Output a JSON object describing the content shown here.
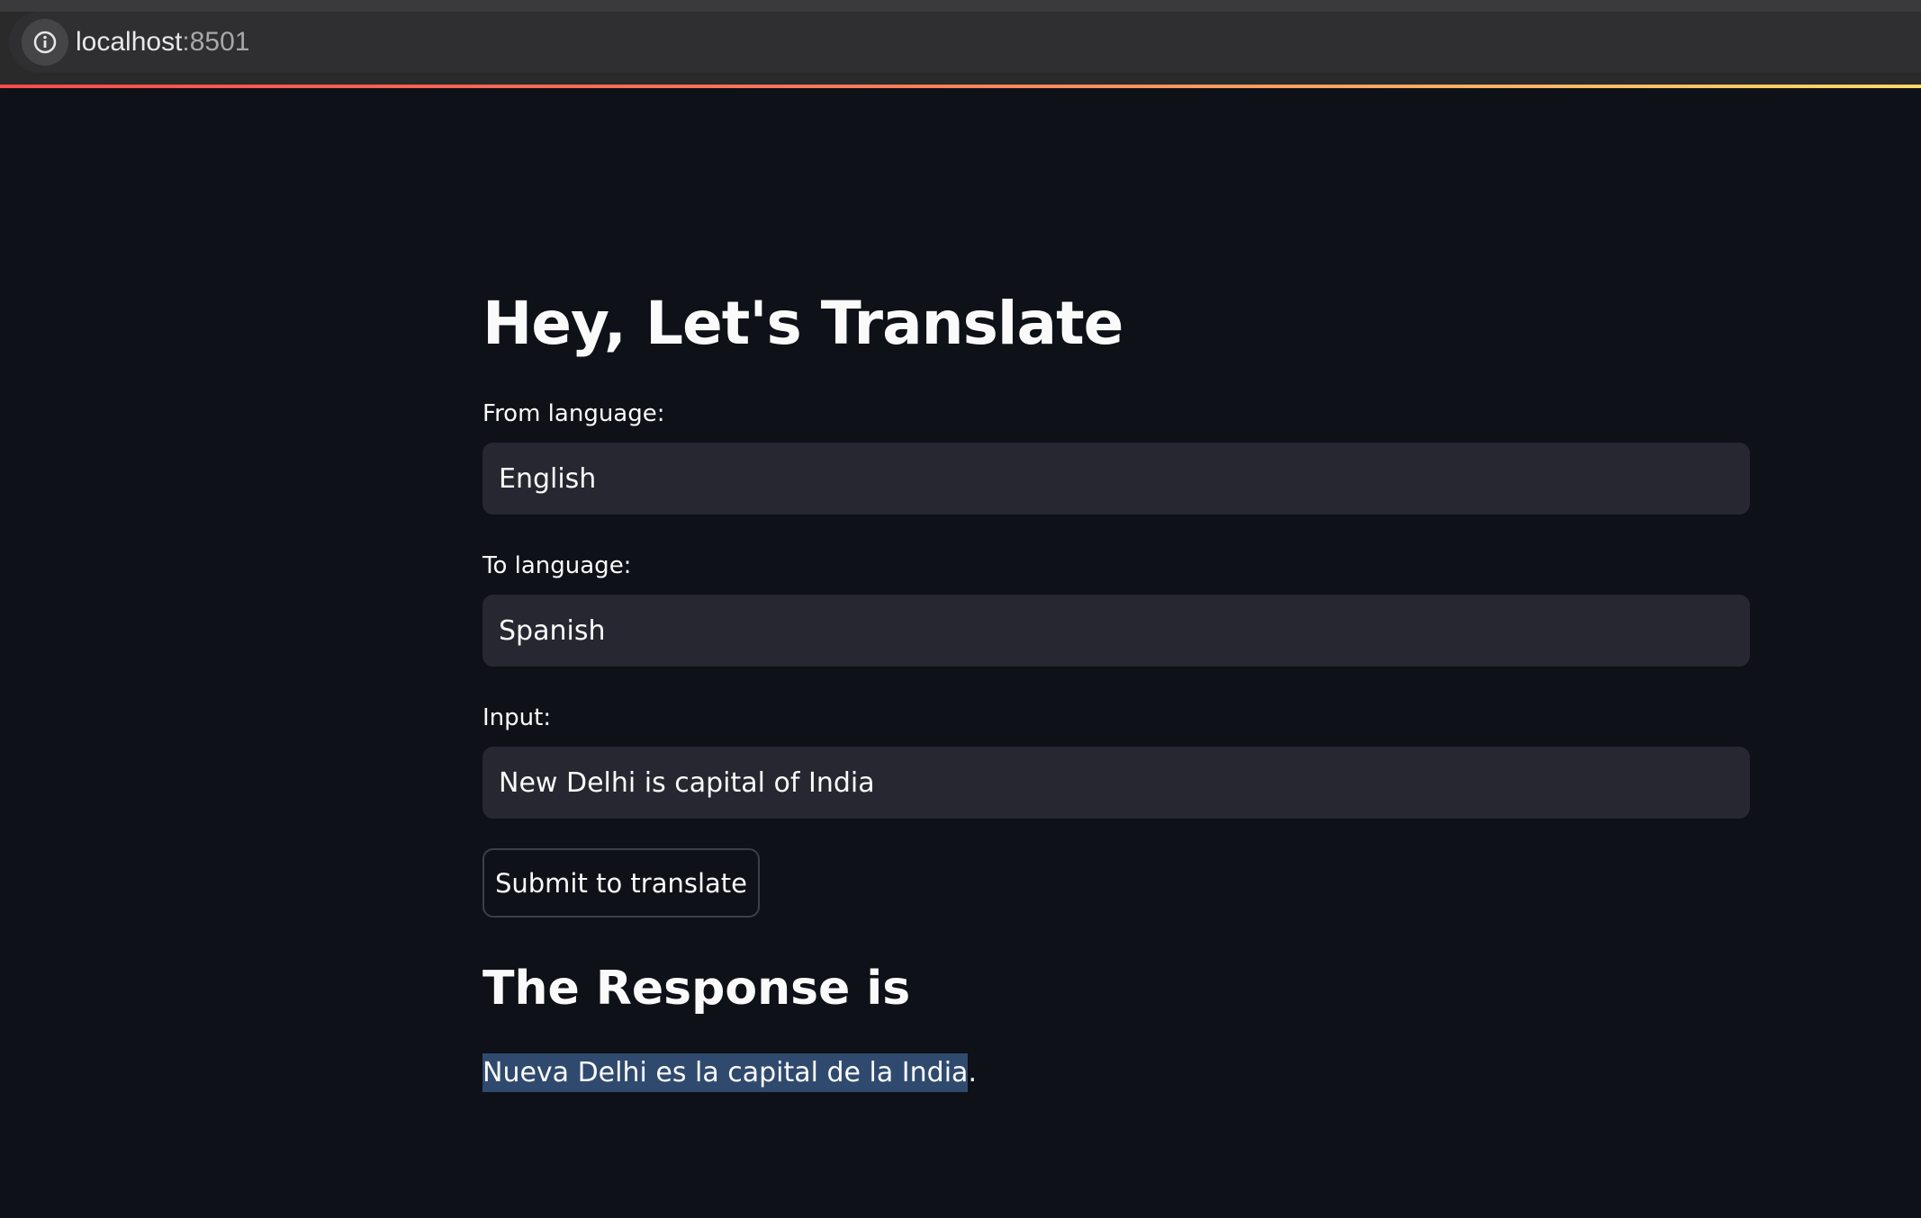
{
  "browser": {
    "url_host": "localhost",
    "url_port": ":8501"
  },
  "app": {
    "title": "Hey, Let's Translate",
    "from_language": {
      "label": "From language:",
      "value": "English"
    },
    "to_language": {
      "label": "To language:",
      "value": "Spanish"
    },
    "input": {
      "label": "Input:",
      "value": "New Delhi is capital of India"
    },
    "submit_label": "Submit to translate",
    "response_header": "The Response is",
    "response": {
      "selected_text": "Nueva Delhi es la capital de la India",
      "trailing_text": "."
    }
  },
  "colors": {
    "background": "#0e1117",
    "input_background": "#262730",
    "accent_gradient_start": "#ff4b4b",
    "accent_gradient_end": "#ffd866",
    "selection": "#2f4a6e"
  },
  "icons": {
    "site_info": "info-icon"
  }
}
